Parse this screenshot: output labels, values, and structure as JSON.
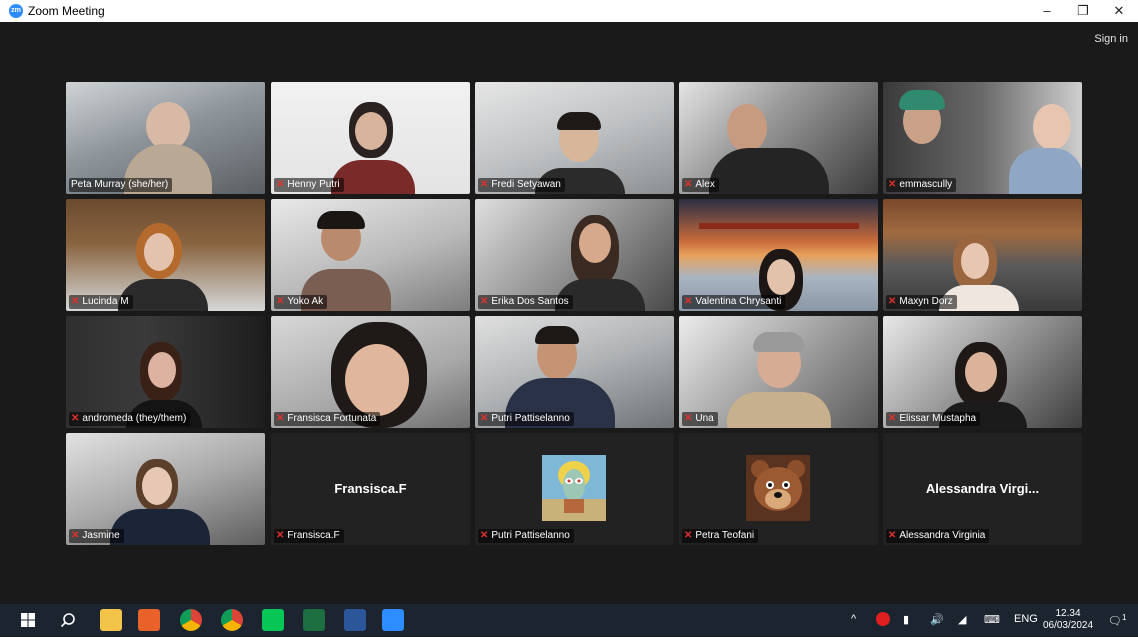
{
  "window": {
    "title": "Zoom Meeting",
    "app_icon": "zm",
    "minimize_icon": "–",
    "maximize_icon": "❐",
    "close_icon": "✕"
  },
  "header": {
    "sign_in": "Sign in"
  },
  "participants": [
    {
      "name": "Peta Murray (she/her)",
      "muted": false,
      "active": true
    },
    {
      "name": "Henny Putri",
      "muted": true
    },
    {
      "name": "Fredi Setyawan",
      "muted": true
    },
    {
      "name": "Alex",
      "muted": true
    },
    {
      "name": "emmascully",
      "muted": true
    },
    {
      "name": "Lucinda M",
      "muted": true
    },
    {
      "name": "Yoko Ak",
      "muted": true
    },
    {
      "name": "Erika Dos Santos",
      "muted": true
    },
    {
      "name": "Valentina Chrysanti",
      "muted": true
    },
    {
      "name": "Maxyn Dorz",
      "muted": true
    },
    {
      "name": "andromeda (they/them)",
      "muted": true
    },
    {
      "name": "Fransisca Fortunata",
      "muted": true
    },
    {
      "name": "Putri Pattiselanno",
      "muted": true
    },
    {
      "name": "Una",
      "muted": true
    },
    {
      "name": "Elissar Mustapha",
      "muted": true
    },
    {
      "name": "Jasmine",
      "muted": true
    },
    {
      "name": "Fransisca.F",
      "muted": true,
      "video_off": true,
      "display_name": "Fransisca.F"
    },
    {
      "name": "Putri Pattiselanno",
      "muted": true,
      "video_off": true,
      "avatar": "squidward-avatar"
    },
    {
      "name": "Petra Teofani",
      "muted": true,
      "video_off": true,
      "avatar": "bear-avatar"
    },
    {
      "name": "Alessandra Virginia",
      "muted": true,
      "video_off": true,
      "display_name": "Alessandra Virgi..."
    }
  ],
  "taskbar": {
    "apps": [
      "windows-start-icon",
      "search-icon",
      "file-explorer-icon",
      "office-icon",
      "chrome-icon",
      "chrome-profile-icon",
      "line-icon",
      "excel-icon",
      "word-icon",
      "zoom-icon"
    ],
    "tray": {
      "chevron": "^",
      "language": "ENG",
      "time": "12.34",
      "date": "06/03/2024",
      "notification_count": "1"
    }
  },
  "colors": {
    "active_speaker": "#b5e33e",
    "muted_icon": "#e0312b",
    "zoom_blue": "#2d8cff",
    "taskbar": "#1c2430"
  }
}
